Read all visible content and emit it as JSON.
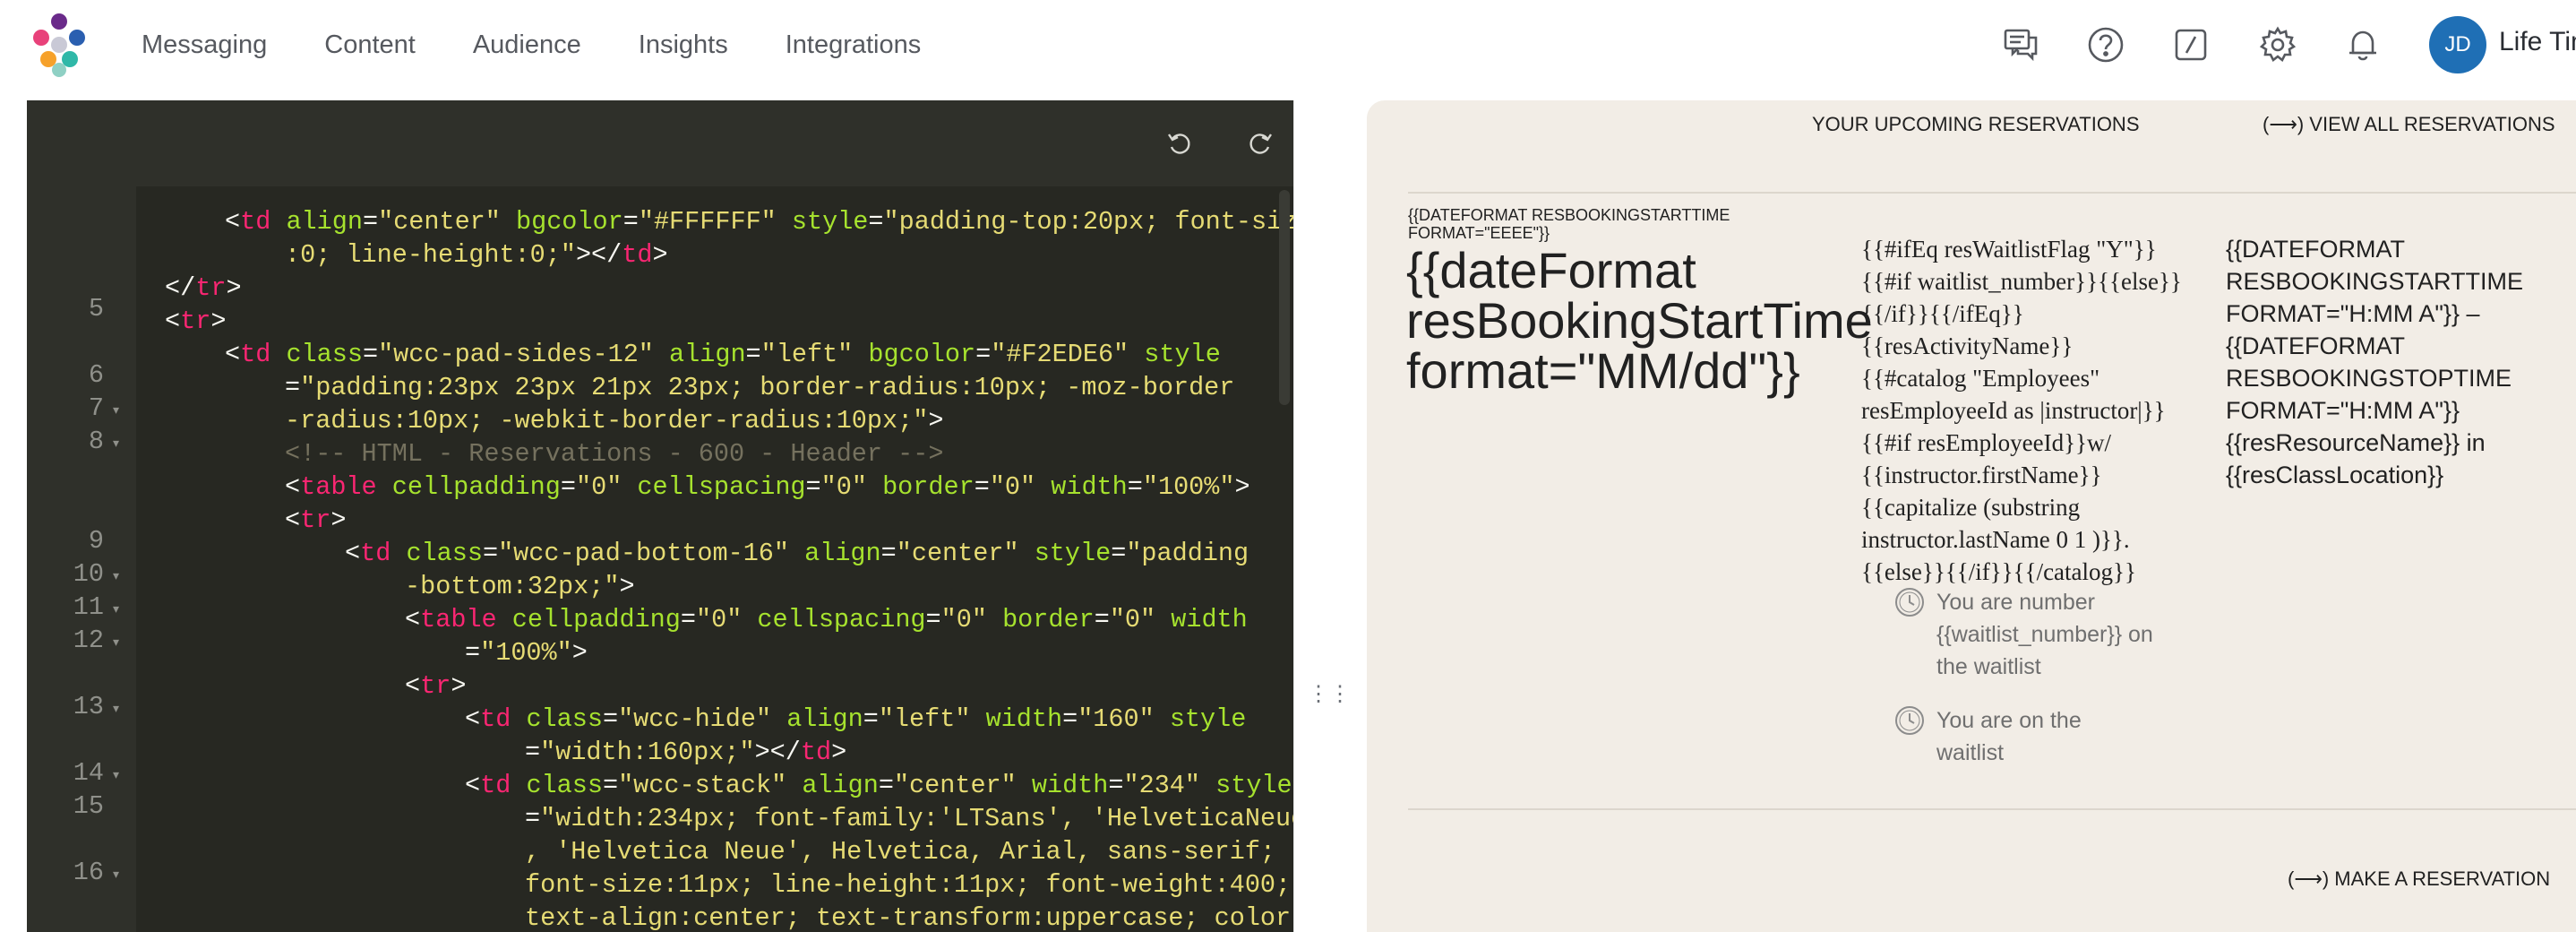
{
  "nav": {
    "links": [
      "Messaging",
      "Content",
      "Audience",
      "Insights",
      "Integrations"
    ],
    "icons": [
      "chat-icon",
      "help-icon",
      "slash-icon",
      "gear-icon",
      "bell-icon"
    ],
    "avatar_initials": "JD",
    "account_name": "Life Time"
  },
  "editor": {
    "toolbar": {
      "undo": "undo-icon",
      "redo": "redo-icon"
    },
    "line_numbers": [
      "5",
      "6",
      "7",
      "8",
      "9",
      "10",
      "11",
      "12",
      "13",
      "14",
      "15",
      "16"
    ],
    "theme": {
      "background": "#272822",
      "tag": "#f92672",
      "attr": "#a6e22e",
      "string": "#e6db74",
      "comment": "#75715e"
    }
  },
  "preview": {
    "upcoming_title": "YOUR UPCOMING RESERVATIONS",
    "view_all": "(⟶) VIEW ALL RESERVATIONS",
    "date_format_small": "{{DATEFORMAT RESBOOKINGSTARTTIME FORMAT=\"EEEE\"}}",
    "date_big_1": "{{dateFormat",
    "date_big_2": "resBookingStartTime",
    "date_big_3": "format=\"MM/dd\"}}",
    "activity_lines": [
      "{{#ifEq resWaitlistFlag \"Y\"}}",
      "{{#if waitlist_number}}{{else}}",
      "{{/if}}{{/ifEq}}",
      "{{resActivityName}}",
      "{{#catalog \"Employees\"",
      "resEmployeeId as |instructor|}}",
      "{{#if resEmployeeId}}w/",
      "{{instructor.firstName}}",
      "{{capitalize (substring",
      "instructor.lastName 0 1 )}}.",
      "{{else}}{{/if}}{{/catalog}}"
    ],
    "waitlist_number_lines": [
      "You are number",
      "{{waitlist_number}} on",
      "the waitlist"
    ],
    "waitlist_on_lines": [
      "You are on the",
      "waitlist"
    ],
    "time_lines": [
      "{{DATEFORMAT",
      "RESBOOKINGSTARTTIME",
      "FORMAT=\"H:MM A\"}} –",
      "{{DATEFORMAT",
      "RESBOOKINGSTOPTIME",
      "FORMAT=\"H:MM A\"}}",
      "{{resResourceName}} in",
      "{{resClassLocation}}"
    ],
    "make_reservation": "(⟶) MAKE A RESERVATION"
  }
}
